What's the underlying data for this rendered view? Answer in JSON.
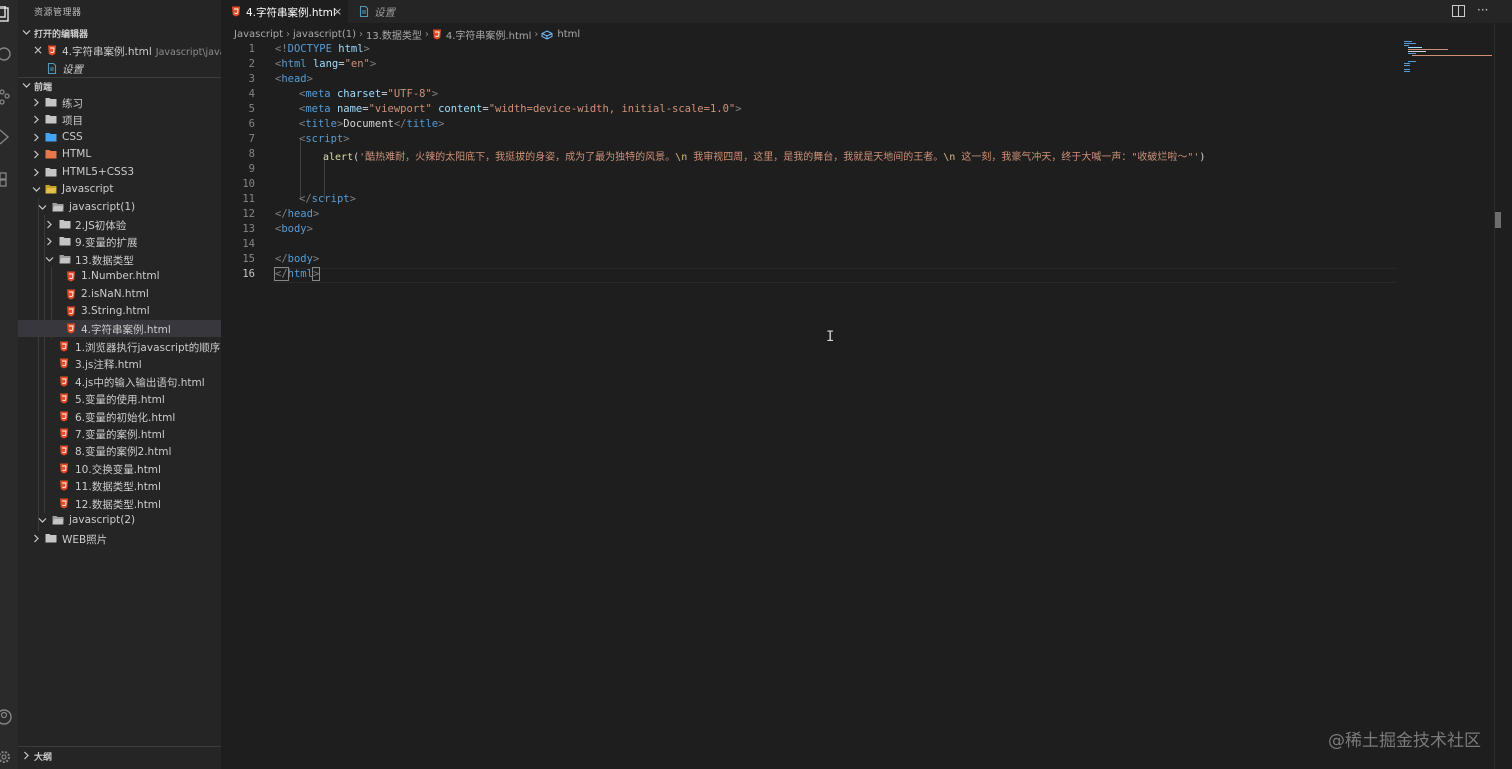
{
  "sidebar": {
    "title": "资源管理器",
    "open_editors_header": "打开的编辑器",
    "open_editors": [
      {
        "name": "4.字符串案例.html",
        "path": "Javascript\\javas..."
      },
      {
        "name": "设置",
        "path": ""
      }
    ],
    "workspace_header": "前端",
    "tree": [
      {
        "label": "练习"
      },
      {
        "label": "项目"
      },
      {
        "label": "CSS"
      },
      {
        "label": "HTML"
      },
      {
        "label": "HTML5+CSS3"
      },
      {
        "label": "Javascript"
      },
      {
        "label": "javascript(1)"
      },
      {
        "label": "2.JS初体验"
      },
      {
        "label": "9.变量的扩展"
      },
      {
        "label": "13.数据类型"
      },
      {
        "label": "1.Number.html"
      },
      {
        "label": "2.isNaN.html"
      },
      {
        "label": "3.String.html"
      },
      {
        "label": "4.字符串案例.html"
      },
      {
        "label": "1.浏览器执行javascript的顺序..."
      },
      {
        "label": "3.js注释.html"
      },
      {
        "label": "4.js中的输入输出语句.html"
      },
      {
        "label": "5.变量的使用.html"
      },
      {
        "label": "6.变量的初始化.html"
      },
      {
        "label": "7.变量的案例.html"
      },
      {
        "label": "8.变量的案例2.html"
      },
      {
        "label": "10.交换变量.html"
      },
      {
        "label": "11.数据类型.html"
      },
      {
        "label": "12.数据类型.html"
      },
      {
        "label": "javascript(2)"
      },
      {
        "label": "WEB照片"
      }
    ],
    "outline_header": "大纲"
  },
  "tabs": [
    {
      "label": "4.字符串案例.html",
      "close": "×"
    },
    {
      "label": "设置"
    }
  ],
  "toolbar": {
    "split_icon": "split-editor-icon",
    "more": "···"
  },
  "breadcrumb": [
    "Javascript",
    "javascript(1)",
    "13.数据类型",
    "4.字符串案例.html",
    "html"
  ],
  "code": {
    "line_numbers": [
      "1",
      "2",
      "3",
      "4",
      "5",
      "6",
      "7",
      "8",
      "9",
      "10",
      "11",
      "12",
      "13",
      "14",
      "15",
      "16"
    ],
    "l1": {
      "a": "<!",
      "b": "DOCTYPE",
      "c": " html",
      "d": ">"
    },
    "l2": {
      "a": "<",
      "b": "html",
      "c": " lang",
      "d": "=",
      "e": "\"en\"",
      "f": ">"
    },
    "l3": {
      "a": "<",
      "b": "head",
      "c": ">"
    },
    "l4": {
      "a": "<",
      "b": "meta",
      "c": " charset",
      "d": "=",
      "e": "\"UTF-8\"",
      "f": ">"
    },
    "l5": {
      "a": "<",
      "b": "meta",
      "c": " name",
      "d": "=",
      "e": "\"viewport\"",
      "f": " content",
      "g": "=",
      "h": "\"width=device-width, initial-scale=1.0\"",
      "i": ">"
    },
    "l6": {
      "a": "<",
      "b": "title",
      "c": ">",
      "d": "Document",
      "e": "</",
      "f": "title",
      "g": ">"
    },
    "l7": {
      "a": "<",
      "b": "script",
      "c": ">"
    },
    "l8": {
      "a": "alert",
      "b": "(",
      "c": "'酷热难耐，火辣的太阳底下，我挺拔的身姿，成为了最为独特的风景。",
      "d": "\\n",
      "e": " 我审视四周，这里，是我的舞台，我就是天地间的王者。",
      "f": "\\n",
      "g": " 这一刻，我豪气冲天，终于大喊一声：\"收破烂啦～\"'",
      "h": ")"
    },
    "l11": {
      "a": "</",
      "b": "script",
      "c": ">"
    },
    "l12": {
      "a": "</",
      "b": "head",
      "c": ">"
    },
    "l13": {
      "a": "<",
      "b": "body",
      "c": ">"
    },
    "l15": {
      "a": "</",
      "b": "body",
      "c": ">"
    },
    "l16": {
      "a": "</",
      "b": "html",
      "c": ">"
    }
  },
  "cursor": "I",
  "watermark": "@稀土掘金技术社区",
  "colors": {
    "tag": "#569cd6",
    "attr": "#9cdcfe",
    "string": "#ce9178",
    "function": "#dcdcaa",
    "html_icon": "#e34c26"
  }
}
